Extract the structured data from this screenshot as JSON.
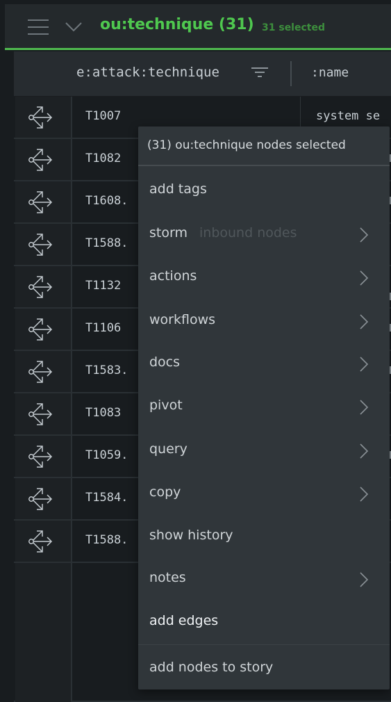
{
  "topbar": {
    "title": "ou:technique (31)",
    "selected_label": "31 selected",
    "accent_color": "#4fc84f"
  },
  "columns": {
    "technique_header": "e:attack:technique",
    "name_header": ":name"
  },
  "rows": [
    {
      "technique": "T1007",
      "icon": "pivot-arrows-icon"
    },
    {
      "technique": "T1082",
      "icon": "pivot-arrows-icon"
    },
    {
      "technique": "T1608.",
      "icon": "pivot-arrows-icon"
    },
    {
      "technique": "T1588.",
      "icon": "pivot-arrows-icon"
    },
    {
      "technique": "T1132",
      "icon": "pivot-arrows-icon"
    },
    {
      "technique": "T1106",
      "icon": "pivot-arrows-icon"
    },
    {
      "technique": "T1583.",
      "icon": "pivot-arrows-icon"
    },
    {
      "technique": "T1083",
      "icon": "pivot-arrows-icon"
    },
    {
      "technique": "T1059.",
      "icon": "pivot-arrows-icon"
    },
    {
      "technique": "T1584.",
      "icon": "pivot-arrows-icon"
    },
    {
      "technique": "T1588.",
      "icon": "pivot-arrows-icon"
    }
  ],
  "first_row_name": "system se",
  "context_menu": {
    "header": "(31) ou:technique nodes selected",
    "items": [
      {
        "label": "add tags",
        "submenu": false
      },
      {
        "label": "storm",
        "hint": "inbound nodes",
        "submenu": true
      },
      {
        "label": "actions",
        "submenu": true
      },
      {
        "label": "workflows",
        "submenu": true
      },
      {
        "label": "docs",
        "submenu": true
      },
      {
        "label": "pivot",
        "submenu": true
      },
      {
        "label": "query",
        "submenu": true
      },
      {
        "label": "copy",
        "submenu": true
      },
      {
        "label": "show history",
        "submenu": false
      },
      {
        "label": "notes",
        "submenu": true
      },
      {
        "label": "add edges",
        "submenu": false
      },
      {
        "label": "add nodes to story",
        "submenu": false
      }
    ]
  }
}
